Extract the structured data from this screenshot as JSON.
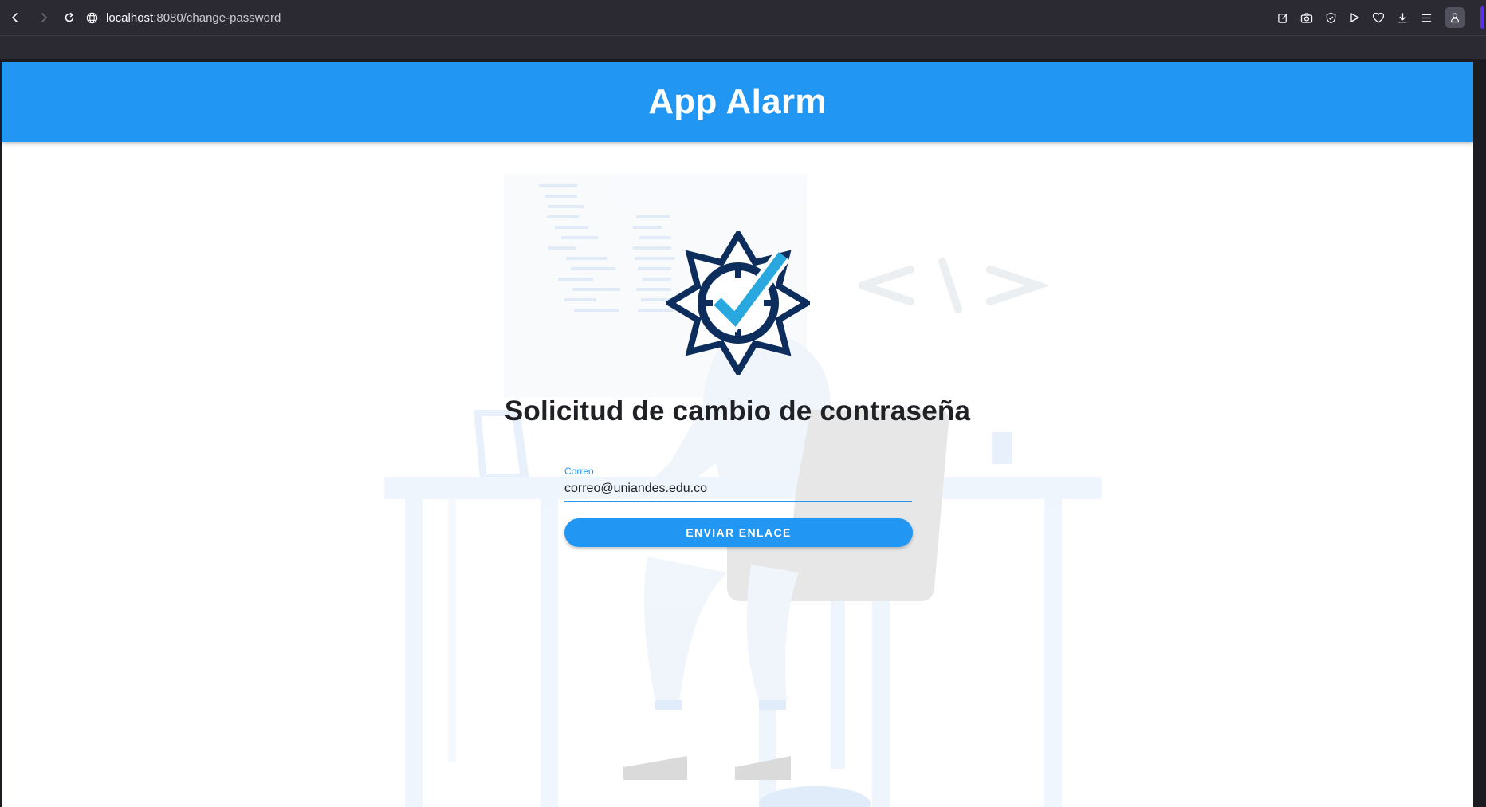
{
  "browser": {
    "url_host": "localhost",
    "url_path": ":8080/change-password"
  },
  "header": {
    "title": "App Alarm"
  },
  "form": {
    "heading": "Solicitud de cambio de contraseña",
    "email_label": "Correo",
    "email_value": "correo@uniandes.edu.co",
    "submit_label": "ENVIAR ENLACE"
  },
  "colors": {
    "primary": "#2196f3",
    "logo_navy": "#0d2e5c",
    "logo_check": "#29a8e0"
  },
  "icons": [
    "back-arrow-icon",
    "forward-arrow-icon",
    "reload-icon",
    "globe-icon",
    "edit-page-icon",
    "camera-icon",
    "shield-icon",
    "play-icon",
    "heart-icon",
    "download-icon",
    "menu-icon",
    "account-icon"
  ]
}
